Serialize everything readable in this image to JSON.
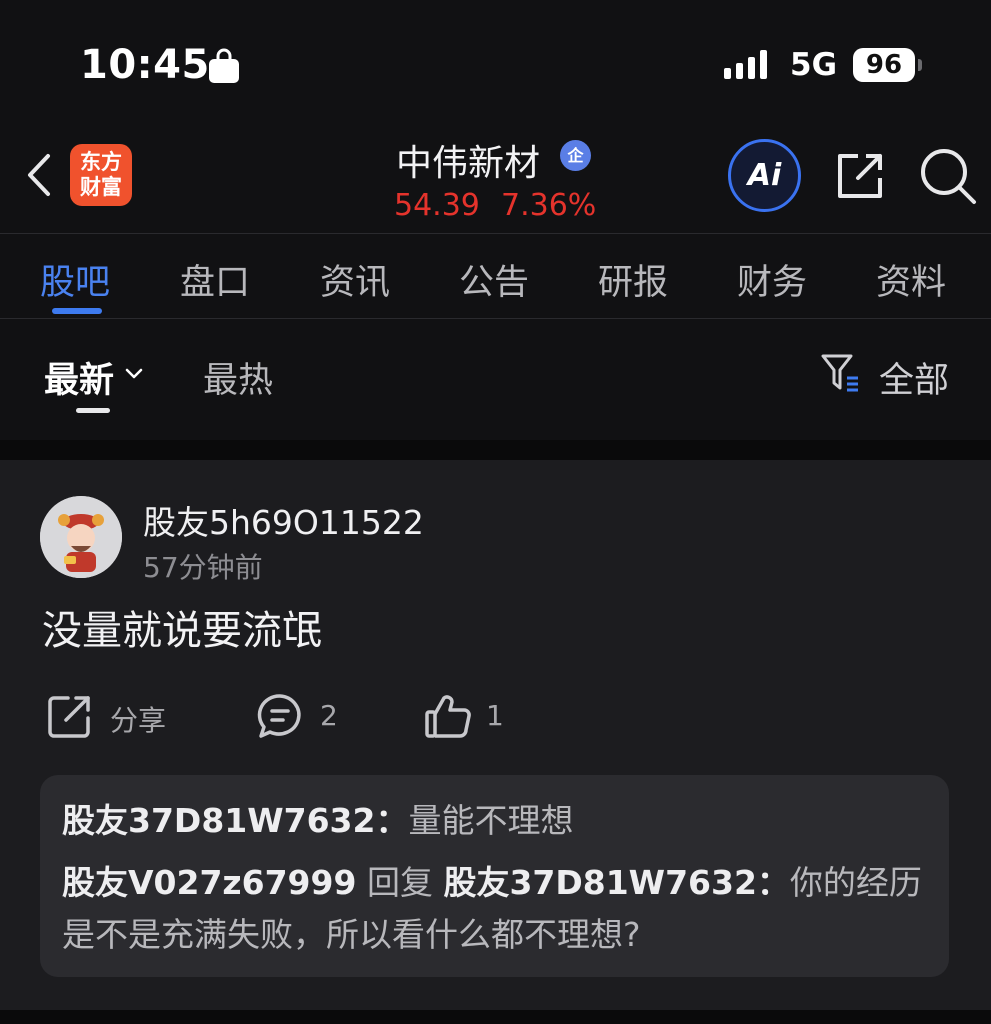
{
  "status_bar": {
    "time": "10:45",
    "network": "5G",
    "battery": "96",
    "icons": [
      "bag-icon",
      "signal-icon"
    ]
  },
  "header": {
    "logo_line1": "东方",
    "logo_line2": "财富",
    "stock_name": "中伟新材",
    "verify_badge": "企",
    "price": "54.39",
    "change": "7.36%",
    "ai_label": "Ai",
    "price_color": "#e5332c",
    "icons": [
      "back-icon",
      "share-icon",
      "search-icon"
    ]
  },
  "tabs": [
    "股吧",
    "盘口",
    "资讯",
    "公告",
    "研报",
    "财务",
    "资料"
  ],
  "active_tab": 0,
  "accent_color": "#3e7bf0",
  "sort": {
    "latest": "最新",
    "hot": "最热",
    "filter": "全部"
  },
  "post": {
    "username": "股友5h69O11522",
    "time": "57分钟前",
    "content": "没量就说要流氓",
    "share_label": "分享",
    "comment_count": "2",
    "like_count": "1",
    "comments": [
      {
        "user": "股友37D81W7632：",
        "text": "量能不理想"
      },
      {
        "user": "股友V027z67999",
        "reply_word": " 回复 ",
        "reply_to": "股友37D81W7632：",
        "text": "你的经历是不是充满失败，所以看什么都不理想?"
      }
    ]
  }
}
